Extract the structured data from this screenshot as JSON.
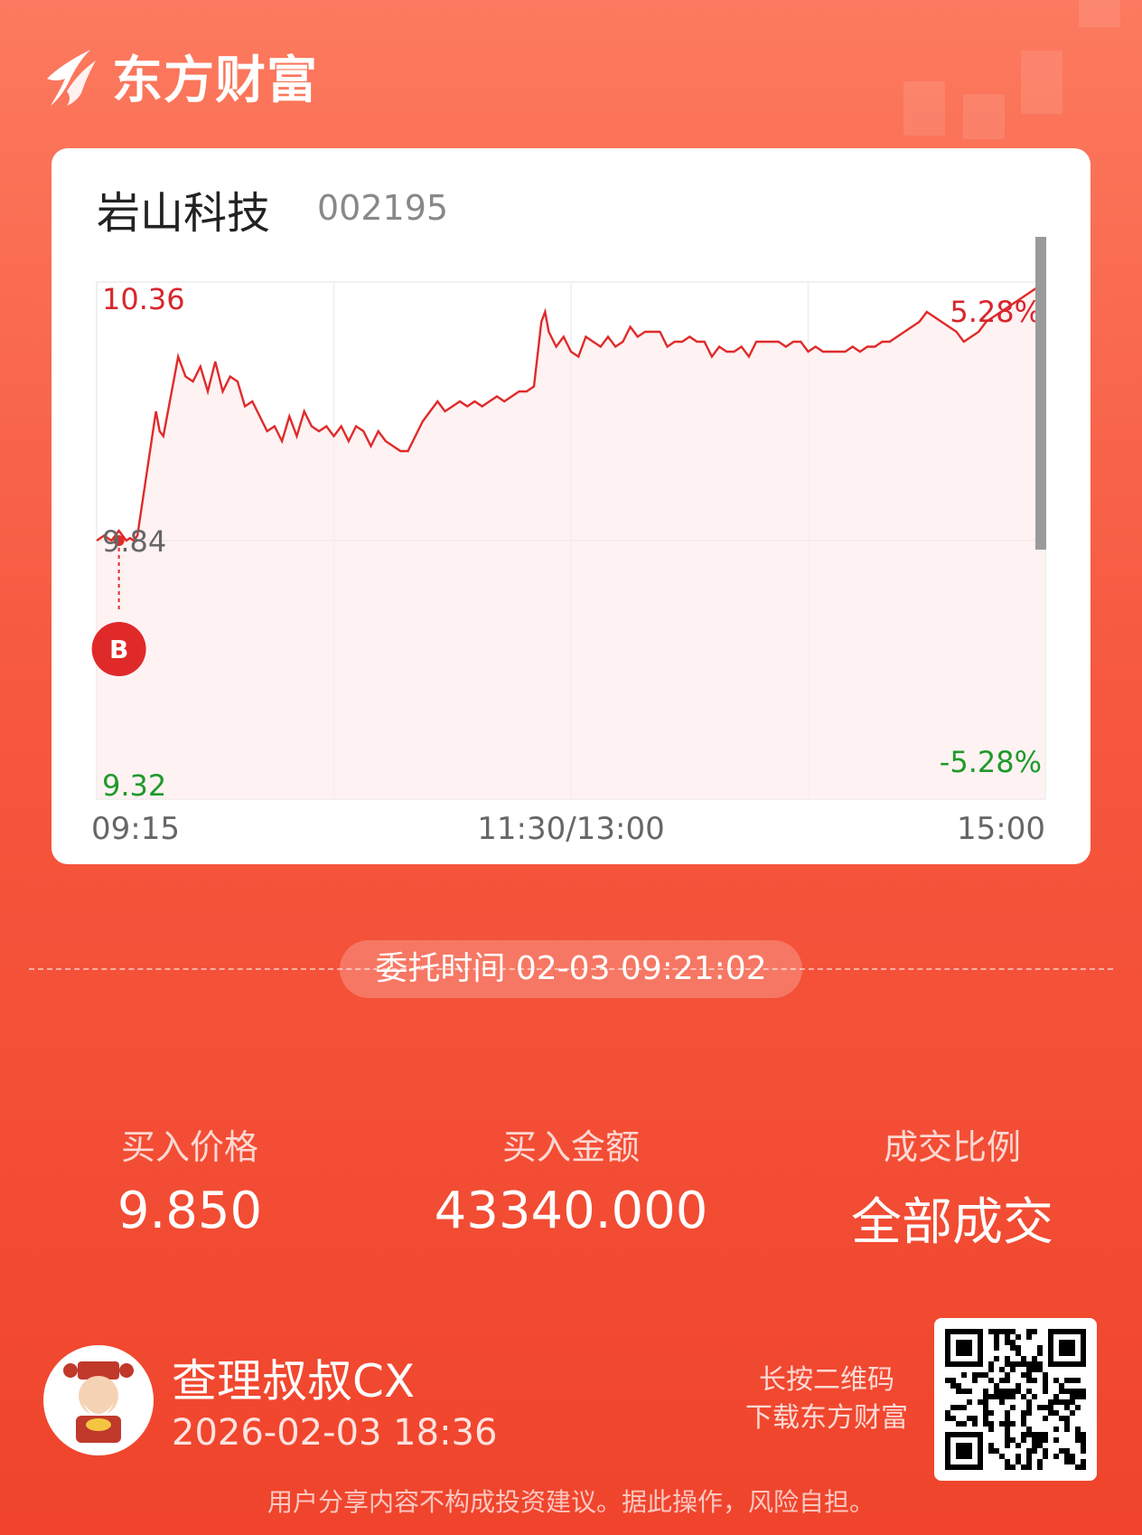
{
  "brand": {
    "name": "东方财富"
  },
  "stock": {
    "name": "岩山科技",
    "code": "002195"
  },
  "chart_data": {
    "type": "line",
    "title": "",
    "x_tick_labels": [
      "09:15",
      "11:30/13:00",
      "15:00"
    ],
    "y_left_labels": {
      "high": "10.36",
      "base": "9.84",
      "low": "9.32"
    },
    "y_right_labels": {
      "high": "5.28%",
      "low": "-5.28%"
    },
    "ylim": [
      9.32,
      10.36
    ],
    "base_price": 9.84,
    "colors": {
      "line": "#e02a2a",
      "fill": "#fdecec",
      "up": "#d7262c",
      "down": "#1f9a2a"
    },
    "marker": {
      "label": "B",
      "time": "09:21",
      "price": 9.84
    },
    "x": [
      0,
      2,
      4,
      6,
      8,
      9,
      10,
      11,
      12,
      14,
      16,
      17,
      18,
      20,
      22,
      24,
      26,
      28,
      30,
      32,
      34,
      36,
      38,
      40,
      42,
      44,
      46,
      48,
      50,
      52,
      54,
      56,
      58,
      60,
      62,
      64,
      66,
      68,
      70,
      72,
      74,
      76,
      78,
      80,
      82,
      84,
      86,
      88,
      90,
      92,
      94,
      96,
      98,
      100,
      102,
      104,
      106,
      108,
      110,
      112,
      114,
      116,
      118,
      120,
      121,
      122,
      124,
      126,
      128,
      130,
      132,
      134,
      136,
      138,
      140,
      142,
      144,
      146,
      148,
      150,
      152,
      154,
      156,
      158,
      160,
      162,
      164,
      166,
      168,
      170,
      172,
      174,
      176,
      178,
      180,
      182,
      184,
      186,
      188,
      190,
      192,
      194,
      196,
      198,
      200,
      202,
      204,
      206,
      208,
      210,
      212,
      214,
      216,
      218,
      220,
      222,
      224,
      226,
      228,
      230,
      232,
      234,
      236,
      238,
      240,
      242,
      244,
      246,
      248,
      250,
      252,
      254,
      256
    ],
    "y": [
      9.84,
      9.85,
      9.84,
      9.86,
      9.84,
      9.845,
      9.84,
      9.85,
      9.9,
      10.0,
      10.1,
      10.06,
      10.05,
      10.13,
      10.21,
      10.17,
      10.16,
      10.19,
      10.14,
      10.2,
      10.14,
      10.17,
      10.16,
      10.11,
      10.12,
      10.09,
      10.06,
      10.07,
      10.04,
      10.09,
      10.05,
      10.1,
      10.07,
      10.06,
      10.07,
      10.05,
      10.07,
      10.04,
      10.07,
      10.06,
      10.03,
      10.06,
      10.04,
      10.03,
      10.02,
      10.02,
      10.05,
      10.08,
      10.1,
      10.12,
      10.1,
      10.11,
      10.12,
      10.11,
      10.12,
      10.11,
      10.12,
      10.13,
      10.12,
      10.13,
      10.14,
      10.14,
      10.15,
      10.28,
      10.3,
      10.26,
      10.23,
      10.25,
      10.22,
      10.21,
      10.25,
      10.24,
      10.23,
      10.25,
      10.23,
      10.24,
      10.27,
      10.25,
      10.26,
      10.26,
      10.26,
      10.23,
      10.24,
      10.24,
      10.25,
      10.24,
      10.24,
      10.21,
      10.23,
      10.22,
      10.22,
      10.23,
      10.21,
      10.24,
      10.24,
      10.24,
      10.24,
      10.23,
      10.24,
      10.24,
      10.22,
      10.23,
      10.22,
      10.22,
      10.22,
      10.22,
      10.23,
      10.22,
      10.23,
      10.23,
      10.24,
      10.24,
      10.25,
      10.26,
      10.27,
      10.28,
      10.3,
      10.29,
      10.28,
      10.27,
      10.26,
      10.24,
      10.25,
      10.26,
      10.28,
      10.29,
      10.3,
      10.31,
      10.32,
      10.33,
      10.34,
      10.35,
      10.36
    ]
  },
  "order": {
    "time_label": "委托时间",
    "time_value": "02-03 09:21:02"
  },
  "stats": [
    {
      "label": "买入价格",
      "value": "9.850"
    },
    {
      "label": "买入金额",
      "value": "43340.000"
    },
    {
      "label": "成交比例",
      "value": "全部成交"
    }
  ],
  "user": {
    "name": "查理叔叔CX",
    "share_time": "2026-02-03 18:36"
  },
  "qr": {
    "hint_line1": "长按二维码",
    "hint_line2": "下载东方财富"
  },
  "disclaimer": "用户分享内容不构成投资建议。据此操作，风险自担。"
}
